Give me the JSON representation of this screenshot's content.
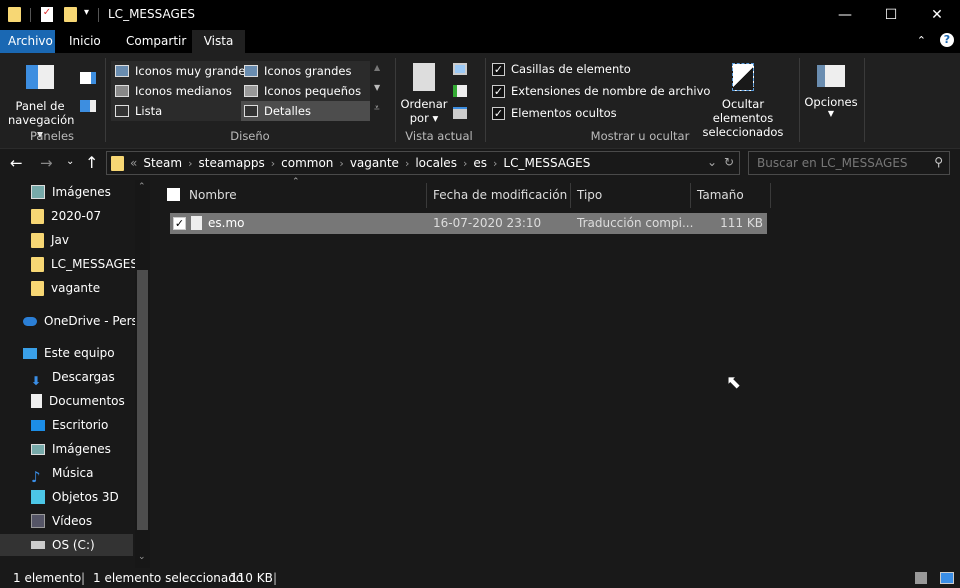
{
  "window": {
    "title": "LC_MESSAGES",
    "minimize": "—",
    "maximize": "☐",
    "close": "✕"
  },
  "tabs": [
    "Archivo",
    "Inicio",
    "Compartir",
    "Vista"
  ],
  "ribbon": {
    "paneles": {
      "nav_pane": "Panel de",
      "nav_pane2": "navegación",
      "label": "Paneles"
    },
    "diseno": {
      "items": [
        "Iconos muy grandes",
        "Iconos grandes",
        "Iconos medianos",
        "Iconos pequeños",
        "Lista",
        "Detalles"
      ],
      "label": "Diseño"
    },
    "vista_actual": {
      "sort": "Ordenar",
      "sort2": "por",
      "label": "Vista actual"
    },
    "mostrar": {
      "checks": [
        {
          "label": "Casillas de elemento",
          "checked": true
        },
        {
          "label": "Extensiones de nombre de archivo",
          "checked": true
        },
        {
          "label": "Elementos ocultos",
          "checked": true
        }
      ],
      "hide": "Ocultar elementos",
      "hide2": "seleccionados",
      "label": "Mostrar u ocultar"
    },
    "opciones": "Opciones"
  },
  "address": {
    "prefix": "«",
    "path": [
      "Steam",
      "steamapps",
      "common",
      "vagante",
      "locales",
      "es",
      "LC_MESSAGES"
    ],
    "search_placeholder": "Buscar en LC_MESSAGES"
  },
  "sidebar": {
    "quick": [
      "Imágenes",
      "2020-07",
      "Jav",
      "LC_MESSAGES",
      "vagante"
    ],
    "onedrive": "OneDrive - Perso",
    "pc": "Este equipo",
    "pc_items": [
      "Descargas",
      "Documentos",
      "Escritorio",
      "Imágenes",
      "Música",
      "Objetos 3D",
      "Vídeos",
      "OS (C:)"
    ]
  },
  "columns": [
    "Nombre",
    "Fecha de modificación",
    "Tipo",
    "Tamaño"
  ],
  "files": [
    {
      "name": "es.mo",
      "date": "16-07-2020 23:10",
      "type": "Traducción compi...",
      "size": "111 KB",
      "selected": true
    }
  ],
  "status": {
    "count": "1 elemento",
    "selected": "1 elemento seleccionado",
    "size": "110 KB"
  }
}
